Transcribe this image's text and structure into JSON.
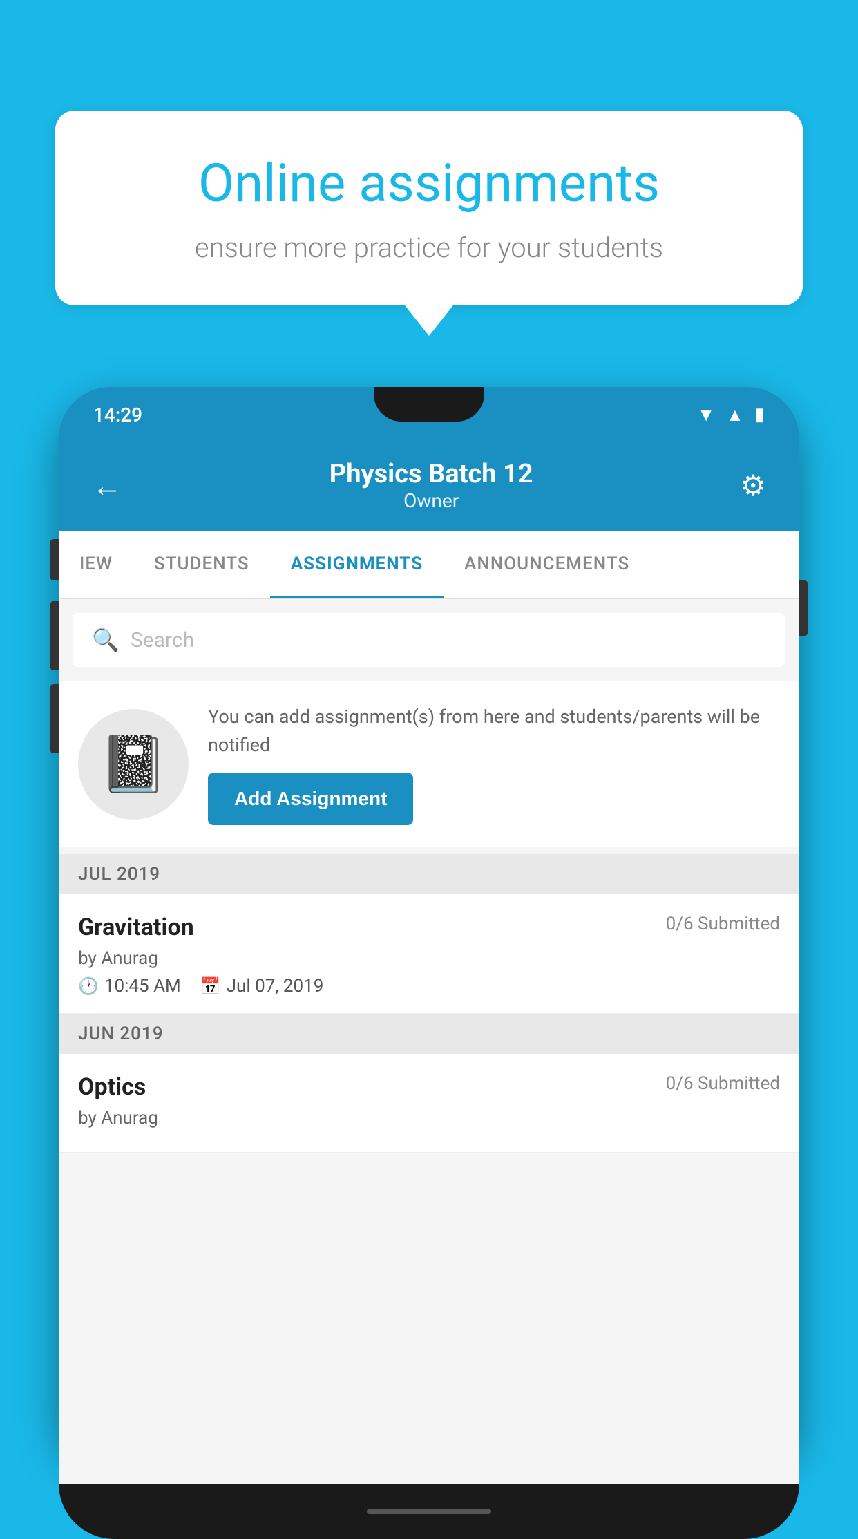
{
  "background_color": "#1ab8e8",
  "speech_bubble": {
    "title": "Online assignments",
    "subtitle": "ensure more practice for your students"
  },
  "phone": {
    "status_bar": {
      "time": "14:29",
      "icons": [
        "wifi",
        "signal",
        "battery"
      ]
    },
    "header": {
      "title": "Physics Batch 12",
      "subtitle": "Owner",
      "back_label": "←",
      "settings_label": "⚙"
    },
    "tabs": [
      {
        "label": "IEW",
        "active": false
      },
      {
        "label": "STUDENTS",
        "active": false
      },
      {
        "label": "ASSIGNMENTS",
        "active": true
      },
      {
        "label": "ANNOUNCEMENTS",
        "active": false
      }
    ],
    "search": {
      "placeholder": "Search"
    },
    "promo": {
      "text": "You can add assignment(s) from here and students/parents will be notified",
      "button_label": "Add Assignment"
    },
    "sections": [
      {
        "month_label": "JUL 2019",
        "assignments": [
          {
            "name": "Gravitation",
            "submitted": "0/6 Submitted",
            "by": "by Anurag",
            "time": "10:45 AM",
            "date": "Jul 07, 2019"
          }
        ]
      },
      {
        "month_label": "JUN 2019",
        "assignments": [
          {
            "name": "Optics",
            "submitted": "0/6 Submitted",
            "by": "by Anurag",
            "time": "",
            "date": ""
          }
        ]
      }
    ]
  }
}
